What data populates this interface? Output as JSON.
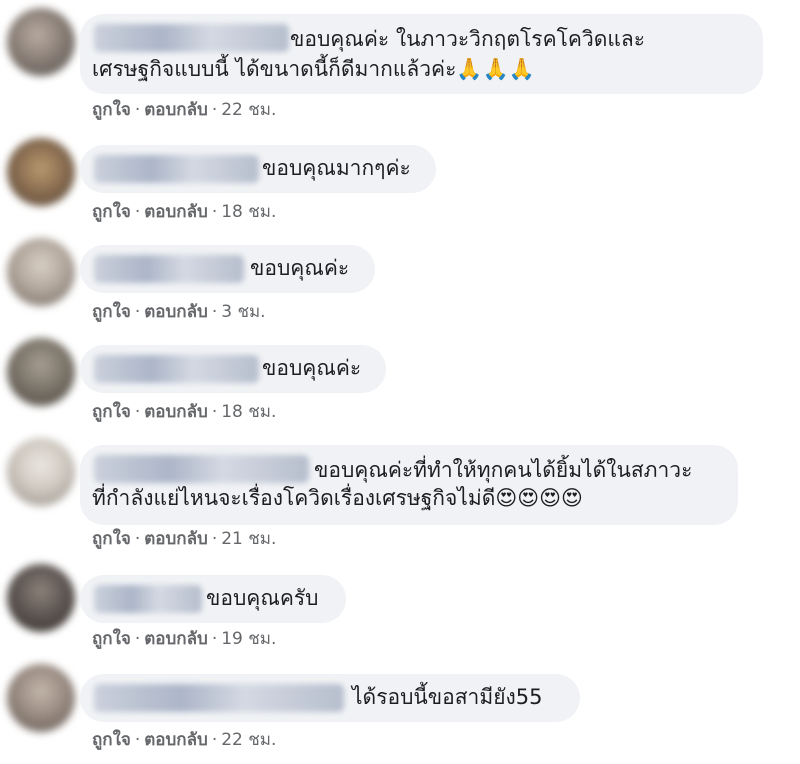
{
  "comments": [
    {
      "avatar_color": "#8a7f77",
      "text_lines": [
        "ขอบคุณค่ะ ในภาวะวิกฤตโรคโควิดและ",
        "เศรษฐกิจแบบนี้ ได้ขนาดนี้ก็ดีมากแล้วค่ะ🙏🙏🙏"
      ],
      "like_label": "ถูกใจ",
      "reply_label": "ตอบกลับ",
      "time": "22 ชม."
    },
    {
      "avatar_color": "#8c6f52",
      "text_lines": [
        "ขอบคุณมากๆค่ะ"
      ],
      "like_label": "ถูกใจ",
      "reply_label": "ตอบกลับ",
      "time": "18 ชม."
    },
    {
      "avatar_color": "#b3a89d",
      "text_lines": [
        "ขอบคุณค่ะ"
      ],
      "like_label": "ถูกใจ",
      "reply_label": "ตอบกลับ",
      "time": "3 ชม."
    },
    {
      "avatar_color": "#7d766b",
      "text_lines": [
        "ขอบคุณค่ะ"
      ],
      "like_label": "ถูกใจ",
      "reply_label": "ตอบกลับ",
      "time": "18 ชม."
    },
    {
      "avatar_color": "#cfc9c1",
      "text_lines": [
        "ขอบคุณค่ะที่ทำให้ทุกคนได้ยิ้มได้ในสภาวะ",
        "ที่กำลังแย่ไหนจะเรื่องโควิดเรื่องเศรษฐกิจไม่ดี😍😍😍😍"
      ],
      "like_label": "ถูกใจ",
      "reply_label": "ตอบกลับ",
      "time": "21 ชม."
    },
    {
      "avatar_color": "#5f5753",
      "text_lines": [
        "ขอบคุณครับ"
      ],
      "like_label": "ถูกใจ",
      "reply_label": "ตอบกลับ",
      "time": "19 ชม."
    },
    {
      "avatar_color": "#9a8c82",
      "text_lines": [
        "ได้รอบนี้ขอสามียัง55"
      ],
      "like_label": "ถูกใจ",
      "reply_label": "ตอบกลับ",
      "time": "22 ชม."
    }
  ],
  "action_separator": "·"
}
